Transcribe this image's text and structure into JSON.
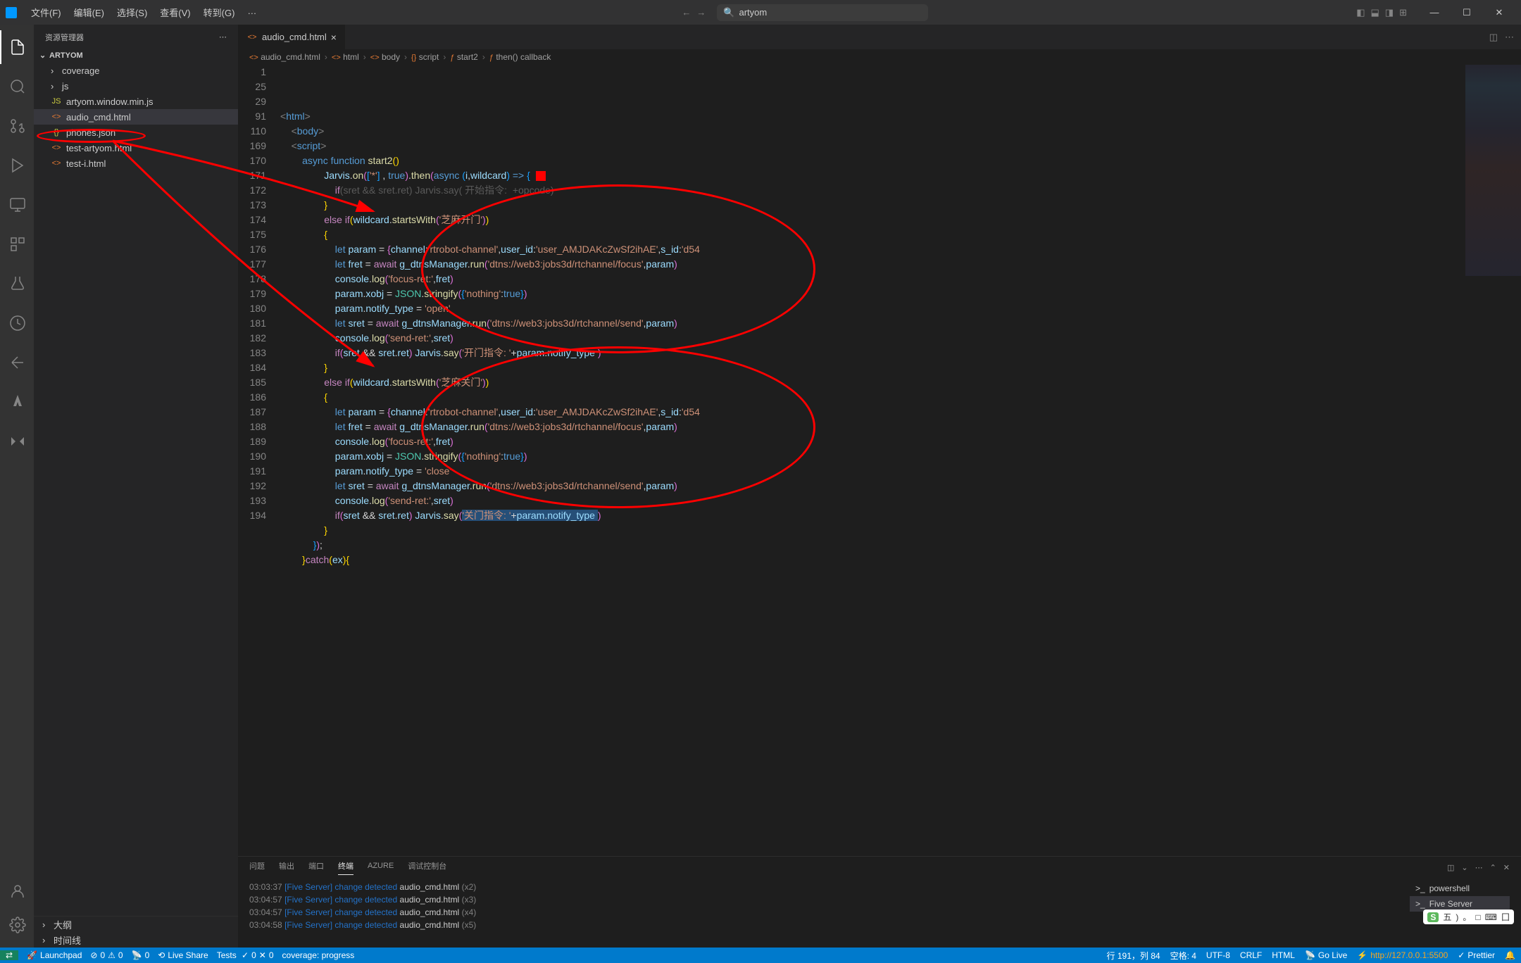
{
  "titlebar": {
    "menus": [
      "文件(F)",
      "编辑(E)",
      "选择(S)",
      "查看(V)",
      "转到(G)",
      "…"
    ],
    "search_value": "artyom"
  },
  "sidebar": {
    "title": "资源管理器",
    "project": "ARTYOM",
    "items": [
      {
        "type": "folder",
        "name": "coverage",
        "depth": 1
      },
      {
        "type": "folder",
        "name": "js",
        "depth": 1
      },
      {
        "type": "file",
        "name": "artyom.window.min.js",
        "icon": "JS",
        "iconClass": "yellow",
        "depth": 1
      },
      {
        "type": "file",
        "name": "audio_cmd.html",
        "icon": "<>",
        "iconClass": "orange",
        "depth": 1,
        "selected": true
      },
      {
        "type": "file",
        "name": "phones.json",
        "icon": "{}",
        "iconClass": "yellow",
        "depth": 1
      },
      {
        "type": "file",
        "name": "test-artyom.html",
        "icon": "<>",
        "iconClass": "orange",
        "depth": 1
      },
      {
        "type": "file",
        "name": "test-i.html",
        "icon": "<>",
        "iconClass": "orange",
        "depth": 1
      }
    ],
    "footer": [
      "大纲",
      "时间线"
    ]
  },
  "editor": {
    "tab_name": "audio_cmd.html",
    "breadcrumbs": [
      "audio_cmd.html",
      "html",
      "body",
      "script",
      "start2",
      "then() callback"
    ],
    "line_numbers": [
      "1",
      "25",
      "29",
      "91",
      "110",
      "169",
      "170",
      "171",
      "172",
      "173",
      "174",
      "175",
      "176",
      "177",
      "178",
      "179",
      "180",
      "181",
      "182",
      "183",
      "184",
      "185",
      "186",
      "187",
      "188",
      "189",
      "190",
      "191",
      "192",
      "193",
      "194"
    ],
    "code_lines": [
      {
        "html": "<span class='k-tag'>&lt;</span><span class='k-blue'>html</span><span class='k-tag'>&gt;</span>"
      },
      {
        "html": "    <span class='k-tag'>&lt;</span><span class='k-blue'>body</span><span class='k-tag'>&gt;</span>"
      },
      {
        "html": "    <span class='k-tag'>&lt;</span><span class='k-blue'>script</span><span class='k-tag'>&gt;</span>"
      },
      {
        "html": "        <span class='k-blue'>async</span> <span class='k-blue'>function</span> <span class='k-fn'>start2</span><span class='k-paren'>()</span>"
      },
      {
        "html": "                <span class='k-lblue'>Jarvis</span>.<span class='k-fn'>on</span><span class='k-paren2'>(</span><span class='k-paren3'>[</span><span class='k-str'>'*'</span><span class='k-paren3'>]</span> , <span class='k-blue'>true</span><span class='k-paren2'>)</span>.<span class='k-fn'>then</span><span class='k-paren2'>(</span><span class='k-blue'>async</span> <span class='k-paren3'>(</span><span class='k-lblue'>i</span>,<span class='k-lblue'>wildcard</span><span class='k-paren3'>)</span> <span class='k-blue'>=&gt;</span> <span class='k-paren3'>{</span>  <span class='red-square'></span>"
      },
      {
        "html": "                    <span class='dim'><span class='k-kw'>if</span>(sret && sret.ret) Jarvis.say( 开始指令:  +opcode)</span>"
      },
      {
        "html": "                <span class='k-paren'>}</span>"
      },
      {
        "html": "                <span class='k-kw'>else</span> <span class='k-kw'>if</span><span class='k-paren'>(</span><span class='k-lblue'>wildcard</span>.<span class='k-fn'>startsWith</span><span class='k-paren2'>(</span><span class='k-str'>'芝麻开门'</span><span class='k-paren2'>)</span><span class='k-paren'>)</span>"
      },
      {
        "html": "                <span class='k-paren'>{</span>"
      },
      {
        "html": "                    <span class='k-blue'>let</span> <span class='k-lblue'>param</span> = <span class='k-paren2'>{</span><span class='k-lblue'>channel</span>:<span class='k-str'>'rtrobot-channel'</span>,<span class='k-lblue'>user_id</span>:<span class='k-str'>'user_AMJDAKcZwSf2ihAE'</span>,<span class='k-lblue'>s_id</span>:<span class='k-str'>'d54</span>"
      },
      {
        "html": "                    <span class='k-blue'>let</span> <span class='k-lblue'>fret</span> = <span class='k-kw'>await</span> <span class='k-lblue'>g_dtnsManager</span>.<span class='k-fn'>run</span><span class='k-paren2'>(</span><span class='k-str'>'dtns://web3:jobs3d/rtchannel/focus'</span>,<span class='k-lblue'>param</span><span class='k-paren2'>)</span>"
      },
      {
        "html": "                    <span class='k-lblue'>console</span>.<span class='k-fn'>log</span><span class='k-paren2'>(</span><span class='k-str'>'focus-ret:'</span>,<span class='k-lblue'>fret</span><span class='k-paren2'>)</span>"
      },
      {
        "html": "                    <span class='k-lblue'>param</span>.<span class='k-lblue'>xobj</span> = <span class='k-type'>JSON</span>.<span class='k-fn'>stringify</span><span class='k-paren2'>(</span><span class='k-paren3'>{</span><span class='k-str'>'nothing'</span>:<span class='k-blue'>true</span><span class='k-paren3'>}</span><span class='k-paren2'>)</span>"
      },
      {
        "html": "                    <span class='k-lblue'>param</span>.<span class='k-lblue'>notify_type</span> = <span class='k-str'>'open'</span>"
      },
      {
        "html": "                    <span class='k-blue'>let</span> <span class='k-lblue'>sret</span> = <span class='k-kw'>await</span> <span class='k-lblue'>g_dtnsManager</span>.<span class='k-fn'>run</span><span class='k-paren2'>(</span><span class='k-str'>'dtns://web3:jobs3d/rtchannel/send'</span>,<span class='k-lblue'>param</span><span class='k-paren2'>)</span>"
      },
      {
        "html": "                    <span class='k-lblue'>console</span>.<span class='k-fn'>log</span><span class='k-paren2'>(</span><span class='k-str'>'send-ret:'</span>,<span class='k-lblue'>sret</span><span class='k-paren2'>)</span>"
      },
      {
        "html": "                    <span class='k-kw'>if</span><span class='k-paren2'>(</span><span class='k-lblue'>sret</span> <span class='k-op'>&&</span> <span class='k-lblue'>sret</span>.<span class='k-lblue'>ret</span><span class='k-paren2'>)</span> <span class='k-lblue'>Jarvis</span>.<span class='k-fn'>say</span><span class='k-paren2'>(</span><span class='k-str'>'开门指令: '</span>+<span class='k-lblue'>param</span>.<span class='k-lblue'>notify_type</span> <span class='k-paren2'>)</span>"
      },
      {
        "html": "                <span class='k-paren'>}</span>"
      },
      {
        "html": "                <span class='k-kw'>else</span> <span class='k-kw'>if</span><span class='k-paren'>(</span><span class='k-lblue'>wildcard</span>.<span class='k-fn'>startsWith</span><span class='k-paren2'>(</span><span class='k-str'>'芝麻关门'</span><span class='k-paren2'>)</span><span class='k-paren'>)</span>"
      },
      {
        "html": "                <span class='k-paren'>{</span>"
      },
      {
        "html": "                    <span class='k-blue'>let</span> <span class='k-lblue'>param</span> = <span class='k-paren2'>{</span><span class='k-lblue'>channel</span>:<span class='k-str'>'rtrobot-channel'</span>,<span class='k-lblue'>user_id</span>:<span class='k-str'>'user_AMJDAKcZwSf2ihAE'</span>,<span class='k-lblue'>s_id</span>:<span class='k-str'>'d54</span>"
      },
      {
        "html": "                    <span class='k-blue'>let</span> <span class='k-lblue'>fret</span> = <span class='k-kw'>await</span> <span class='k-lblue'>g_dtnsManager</span>.<span class='k-fn'>run</span><span class='k-paren2'>(</span><span class='k-str'>'dtns://web3:jobs3d/rtchannel/focus'</span>,<span class='k-lblue'>param</span><span class='k-paren2'>)</span>"
      },
      {
        "html": "                    <span class='k-lblue'>console</span>.<span class='k-fn'>log</span><span class='k-paren2'>(</span><span class='k-str'>'focus-ret:'</span>,<span class='k-lblue'>fret</span><span class='k-paren2'>)</span>"
      },
      {
        "html": "                    <span class='k-lblue'>param</span>.<span class='k-lblue'>xobj</span> = <span class='k-type'>JSON</span>.<span class='k-fn'>stringify</span><span class='k-paren2'>(</span><span class='k-paren3'>{</span><span class='k-str'>'nothing'</span>:<span class='k-blue'>true</span><span class='k-paren3'>}</span><span class='k-paren2'>)</span>"
      },
      {
        "html": "                    <span class='k-lblue'>param</span>.<span class='k-lblue'>notify_type</span> = <span class='k-str'>'close'</span>"
      },
      {
        "html": "                    <span class='k-blue'>let</span> <span class='k-lblue'>sret</span> = <span class='k-kw'>await</span> <span class='k-lblue'>g_dtnsManager</span>.<span class='k-fn'>run</span><span class='k-paren2'>(</span><span class='k-str'>'dtns://web3:jobs3d/rtchannel/send'</span>,<span class='k-lblue'>param</span><span class='k-paren2'>)</span>"
      },
      {
        "html": "                    <span class='k-lblue'>console</span>.<span class='k-fn'>log</span><span class='k-paren2'>(</span><span class='k-str'>'send-ret:'</span>,<span class='k-lblue'>sret</span><span class='k-paren2'>)</span>"
      },
      {
        "html": "                    <span class='k-kw'>if</span><span class='k-paren2'>(</span><span class='k-lblue'>sret</span> <span class='k-op'>&&</span> <span class='k-lblue'>sret</span>.<span class='k-lblue'>ret</span><span class='k-paren2'>)</span> <span class='k-lblue'>Jarvis</span>.<span class='k-fn'>say</span><span class='k-paren2'>(</span><span style='background:#264f78'><span class='k-str'>'关门指令: '</span>+<span class='k-lblue'>param</span>.<span class='k-lblue'>notify_type</span> </span><span class='k-paren2'>)</span>"
      },
      {
        "html": "                <span class='k-paren'>}</span>"
      },
      {
        "html": "            <span class='k-paren3'>}</span><span class='k-paren2'>)</span>;"
      },
      {
        "html": "        <span class='k-paren'>}</span><span class='k-kw'>catch</span><span class='k-paren'>(</span><span class='k-lblue'>ex</span><span class='k-paren'>){</span>"
      }
    ]
  },
  "panel": {
    "tabs": [
      "问题",
      "输出",
      "端口",
      "终端",
      "AZURE",
      "调试控制台"
    ],
    "active_tab": 3,
    "terminal_lines": [
      {
        "time": "03:03:37",
        "server": "[Five Server]",
        "msg": "change detected",
        "file": "audio_cmd.html",
        "count": "(x2)"
      },
      {
        "time": "03:04:57",
        "server": "[Five Server]",
        "msg": "change detected",
        "file": "audio_cmd.html",
        "count": "(x3)"
      },
      {
        "time": "03:04:57",
        "server": "[Five Server]",
        "msg": "change detected",
        "file": "audio_cmd.html",
        "count": "(x4)"
      },
      {
        "time": "03:04:58",
        "server": "[Five Server]",
        "msg": "change detected",
        "file": "audio_cmd.html",
        "count": "(x5)"
      }
    ],
    "terminal_items": [
      {
        "name": "powershell",
        "icon": ">_"
      },
      {
        "name": "Five Server",
        "icon": ">_",
        "active": true
      }
    ]
  },
  "statusbar": {
    "launchpad": "Launchpad",
    "errors": "0",
    "warnings": "0",
    "ports": "0",
    "live_share": "Live Share",
    "tests": "Tests",
    "tests_pass": "0",
    "tests_fail": "0",
    "coverage": "coverage: progress",
    "position": "行 191，列 84",
    "spaces": "空格: 4",
    "encoding": "UTF-8",
    "eol": "CRLF",
    "lang": "HTML",
    "golive": "Go Live",
    "server": "http://127.0.0.1:5500",
    "prettier": "Prettier"
  },
  "ime": {
    "chars": [
      "五",
      ")",
      "。",
      "□",
      "⌨",
      "囗"
    ]
  }
}
